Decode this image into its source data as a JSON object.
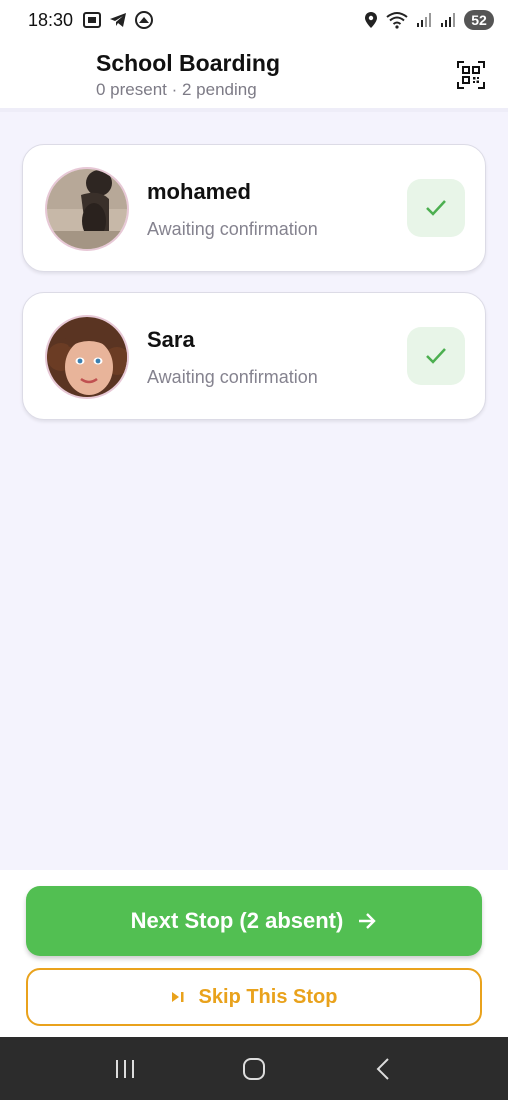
{
  "status_bar": {
    "time": "18:30",
    "battery": "52",
    "left_icons": [
      "screenshot-icon",
      "telegram-icon",
      "app-icon"
    ],
    "right_icons": [
      "location-icon",
      "wifi-icon",
      "signal-icon",
      "signal-icon-2"
    ]
  },
  "header": {
    "title": "School Boarding",
    "subtitle": "0 present · 2 pending",
    "qr_icon": "qr-scan-icon"
  },
  "students": [
    {
      "name": "mohamed",
      "status": "Awaiting confirmation",
      "confirm_icon": "check-icon"
    },
    {
      "name": "Sara",
      "status": "Awaiting confirmation",
      "confirm_icon": "check-icon"
    }
  ],
  "actions": {
    "next_stop_label": "Next Stop (2 absent)",
    "skip_label": "Skip This Stop"
  },
  "colors": {
    "primary_green": "#52bf52",
    "confirm_bg": "#e8f5e8",
    "skip_orange": "#e9a21c",
    "background": "#f4f3fd"
  },
  "nav": [
    "recent-apps-icon",
    "home-icon",
    "back-icon"
  ]
}
